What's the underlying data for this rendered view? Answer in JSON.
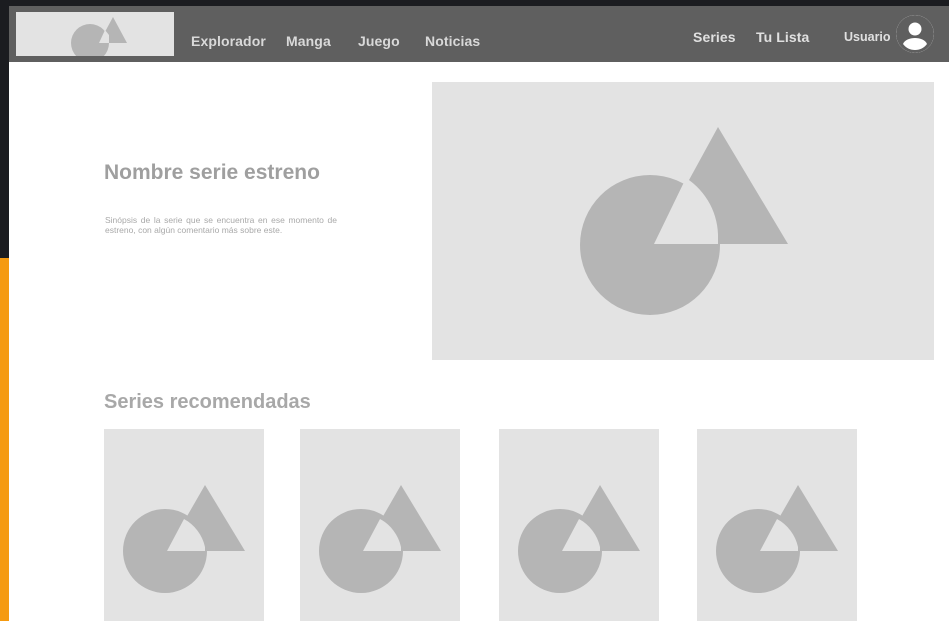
{
  "navbar": {
    "logo_icon": "shapes-placeholder-icon",
    "links": [
      "Explorador",
      "Manga",
      "Juego",
      "Noticias"
    ],
    "right_links": [
      "Series",
      "Tu Lista"
    ],
    "user_label": "Usuario",
    "avatar_icon": "user-avatar-icon",
    "background": "#5f5f5f"
  },
  "hero": {
    "title": "Nombre serie estreno",
    "synopsis": "Sinópsis de la serie que se encuentra en ese momento de estreno, con algún comentario más sobre este.",
    "image_icon": "shapes-placeholder-icon"
  },
  "recommended": {
    "title": "Series recomendadas",
    "card_icon": "shapes-placeholder-icon"
  },
  "colors": {
    "placeholder_bg": "#e3e3e3",
    "placeholder_shape": "#b5b5b5",
    "accent": "#f59a10"
  }
}
